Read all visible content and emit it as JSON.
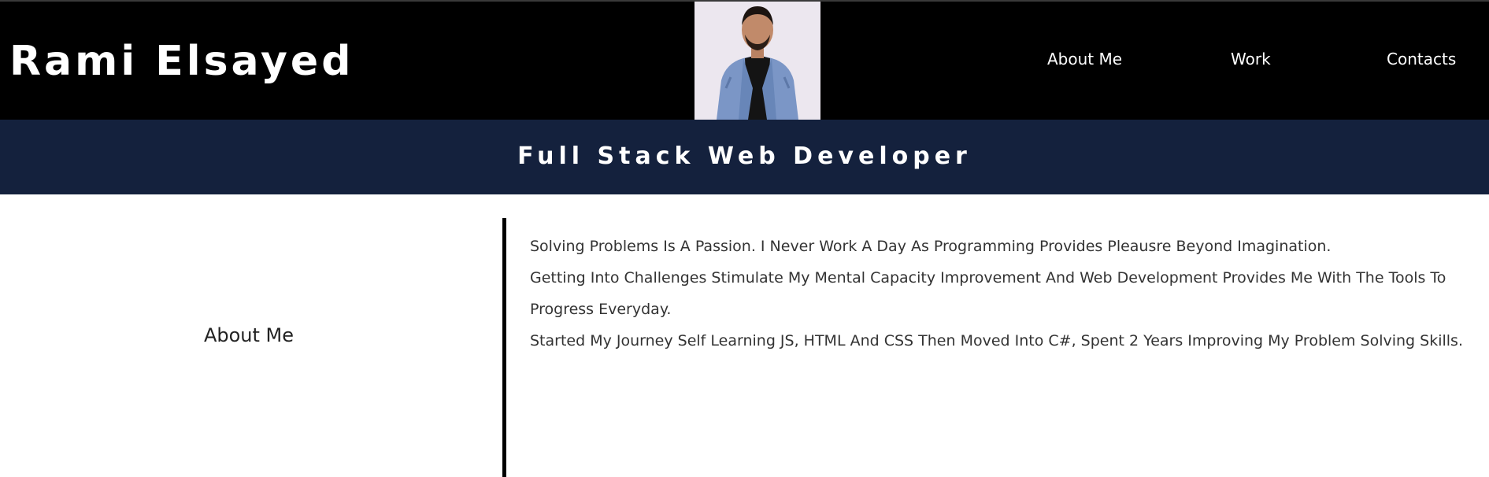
{
  "header": {
    "brand": "Rami Elsayed",
    "nav": [
      {
        "label": "About Me"
      },
      {
        "label": "Work"
      },
      {
        "label": "Contacts"
      }
    ],
    "avatar_icon": "profile-photo"
  },
  "banner": {
    "title": "Full Stack Web Developer"
  },
  "about": {
    "heading": "About Me",
    "paragraphs": [
      "Solving Problems Is A Passion. I Never Work A Day As Programming Provides Pleausre Beyond Imagination.",
      "Getting Into Challenges Stimulate My Mental Capacity Improvement And Web Development Provides Me With The Tools To Progress Everyday.",
      "Started My Journey Self Learning JS, HTML And CSS Then Moved Into C#, Spent 2 Years Improving My Problem Solving Skills."
    ]
  },
  "colors": {
    "header_bg": "#000000",
    "banner_bg": "#14213d",
    "divider": "#000000"
  }
}
